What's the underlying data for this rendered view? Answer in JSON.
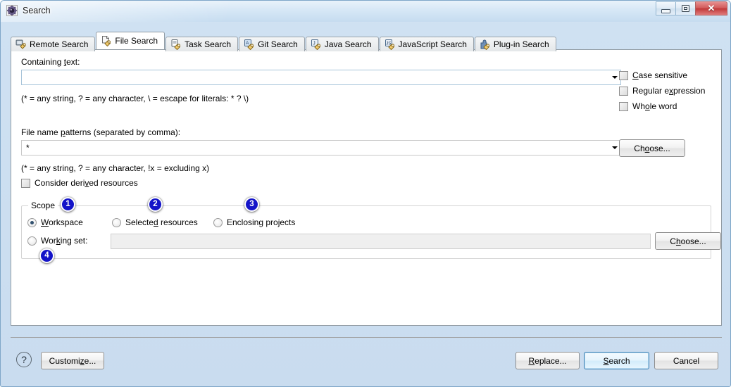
{
  "window": {
    "title": "Search",
    "icon": "search-gear-icon",
    "caption_buttons": {
      "minimize": "minimize-icon",
      "maximize": "maximize-icon",
      "close": "✕"
    }
  },
  "tabs": [
    {
      "label": "Remote Search",
      "icon": "remote-search-icon",
      "selected": false
    },
    {
      "label": "File Search",
      "icon": "file-search-icon",
      "selected": true
    },
    {
      "label": "Task Search",
      "icon": "task-search-icon",
      "selected": false
    },
    {
      "label": "Git Search",
      "icon": "git-search-icon",
      "selected": false
    },
    {
      "label": "Java Search",
      "icon": "java-search-icon",
      "selected": false
    },
    {
      "label": "JavaScript Search",
      "icon": "javascript-search-icon",
      "selected": false
    },
    {
      "label": "Plug-in Search",
      "icon": "plugin-search-icon",
      "selected": false
    }
  ],
  "containing_text": {
    "label_pre": "Containing ",
    "label_mnemonic": "t",
    "label_post": "ext:",
    "value": "",
    "placeholder": "",
    "hint": "(* = any string, ? = any character, \\ = escape for literals: * ? \\)",
    "dropdown_icon": "chevron-down-icon"
  },
  "options": [
    {
      "pre": "",
      "mnemonic": "C",
      "post": "ase sensitive",
      "checked": false
    },
    {
      "pre": "Regular e",
      "mnemonic": "x",
      "post": "pression",
      "checked": false
    },
    {
      "pre": "Wh",
      "mnemonic": "o",
      "post": "le word",
      "checked": false
    }
  ],
  "file_patterns": {
    "label_pre": "File name ",
    "label_mnemonic": "p",
    "label_post": "atterns (separated by comma):",
    "value": "*",
    "hint": "(* = any string, ? = any character, !x = excluding x)",
    "choose_button": {
      "pre": "Ch",
      "mnemonic": "o",
      "post": "ose..."
    },
    "dropdown_icon": "chevron-down-icon"
  },
  "derived": {
    "pre": "Consider deri",
    "mnemonic": "v",
    "post": "ed resources",
    "checked": false
  },
  "scope": {
    "legend": "Scope",
    "radios": [
      {
        "pre": "",
        "mnemonic": "W",
        "post": "orkspace",
        "selected": true,
        "badge": "1"
      },
      {
        "pre": "Selecte",
        "mnemonic": "d",
        "post": " resources",
        "selected": false,
        "badge": "2"
      },
      {
        "pre": "Enclosing projects",
        "mnemonic": "",
        "post": "",
        "selected": false,
        "badge": "3"
      }
    ],
    "working_set": {
      "pre": "Wor",
      "mnemonic": "k",
      "post": "ing set:",
      "selected": false,
      "value": "",
      "badge": "4",
      "choose_button": {
        "pre": "C",
        "mnemonic": "h",
        "post": "oose..."
      }
    }
  },
  "footer": {
    "help_icon": "?",
    "customize": {
      "pre": "Customi",
      "mnemonic": "z",
      "post": "e..."
    },
    "replace": {
      "pre": "",
      "mnemonic": "R",
      "post": "eplace..."
    },
    "search": {
      "pre": "",
      "mnemonic": "S",
      "post": "earch"
    },
    "cancel": {
      "pre": "Cancel",
      "mnemonic": "",
      "post": ""
    }
  },
  "colors": {
    "badge_blue": "#1414c8",
    "title_gradient_top": "#e9f2fa",
    "window_blue": "#c9dcef",
    "default_button_border": "#3c7fb1",
    "close_button_red": "#c03a3a"
  }
}
